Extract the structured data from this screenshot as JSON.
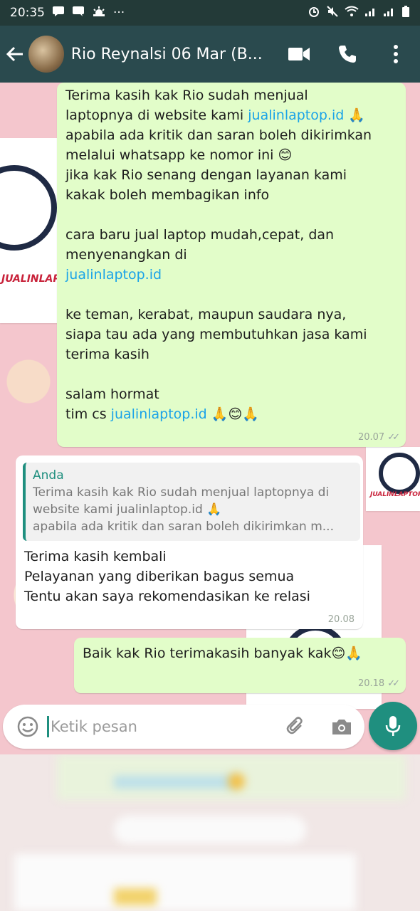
{
  "status_bar": {
    "time": "20:35",
    "dots": "···"
  },
  "header": {
    "title": "Rio Reynalsi 06 Mar (B..."
  },
  "messages": {
    "m1": {
      "lines": [
        "Terima kasih kak Rio sudah menjual",
        "laptopnya di website kami ",
        "apabila ada kritik dan saran boleh dikirimkan",
        "melalui whatsapp ke nomor ini ",
        "jika kak Rio senang dengan layanan kami",
        "kakak boleh membagikan info",
        "",
        "cara baru jual laptop mudah,cepat, dan",
        "menyenangkan di",
        "",
        "",
        "ke teman, kerabat, maupun saudara nya,",
        "siapa tau ada yang membutuhkan jasa kami",
        "terima kasih",
        "",
        "salam hormat",
        "tim cs "
      ],
      "link": "jualinlaptop.id",
      "emoji_pray": "🙏",
      "emoji_smile": "😊",
      "time": "20.07"
    },
    "m2": {
      "quote_sender": "Anda",
      "quote_lines": [
        "Terima kasih kak Rio sudah menjual laptopnya di",
        "website kami jualinlaptop.id 🙏",
        "apabila ada kritik dan saran boleh dikirimkan m..."
      ],
      "lines": [
        "Terima kasih kembali",
        "Pelayanan yang diberikan bagus semua",
        "Tentu akan saya rekomendasikan ke relasi"
      ],
      "time": "20.08"
    },
    "m3": {
      "text": "Baik kak Rio terimakasih banyak kak",
      "emoji": "😊🙏",
      "time": "20.18"
    }
  },
  "background_logo_text": "JUALINLAPTOP.ID",
  "composer": {
    "placeholder": "Ketik pesan"
  }
}
